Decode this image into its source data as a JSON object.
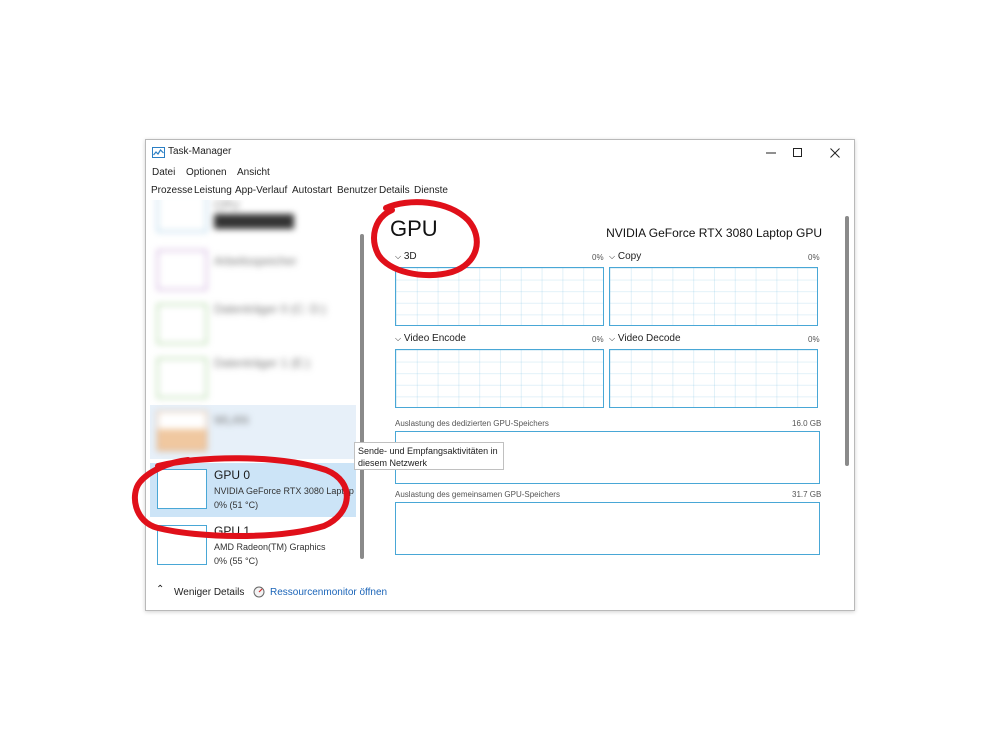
{
  "window": {
    "title": "Task-Manager"
  },
  "menu": [
    "Datei",
    "Optionen",
    "Ansicht"
  ],
  "tabs": [
    "Prozesse",
    "Leistung",
    "App-Verlauf",
    "Autostart",
    "Benutzer",
    "Details",
    "Dienste"
  ],
  "active_tab": "Leistung",
  "sidebar": {
    "items": [
      {
        "title": "CPU",
        "subtitle": "",
        "blurred": true
      },
      {
        "title": "Arbeitsspeicher",
        "subtitle": "",
        "blurred": true
      },
      {
        "title": "Datenträger 0 (C: D:)",
        "subtitle": "",
        "blurred": true
      },
      {
        "title": "Datenträger 1 (E:)",
        "subtitle": "",
        "blurred": true
      },
      {
        "title": "WLAN",
        "subtitle": "",
        "blurred": true
      },
      {
        "title": "GPU 0",
        "subtitle": "NVIDIA GeForce RTX 3080 Laptop",
        "value": "0%  (51 °C)"
      },
      {
        "title": "GPU 1",
        "subtitle": "AMD Radeon(TM) Graphics",
        "value": "0%  (55 °C)"
      }
    ],
    "colors": {
      "cpu": "#7fb8dc",
      "memory": "#b07cc6",
      "disk": "#7fbf6a",
      "wlan": "#d8a070",
      "gpu": "#49a7d6"
    }
  },
  "tooltip": "Sende- und Empfangsaktivitäten in diesem Netzwerk",
  "main": {
    "title": "GPU",
    "model": "NVIDIA GeForce RTX 3080 Laptop GPU",
    "engines": [
      {
        "name": "3D",
        "percent": "0%"
      },
      {
        "name": "Copy",
        "percent": "0%"
      },
      {
        "name": "Video Encode",
        "percent": "0%"
      },
      {
        "name": "Video Decode",
        "percent": "0%"
      }
    ],
    "dedicated_memory": {
      "label": "Auslastung des dedizierten GPU-Speichers",
      "max": "16.0 GB"
    },
    "shared_memory": {
      "label": "Auslastung des gemeinsamen GPU-Speichers",
      "max": "31.7 GB"
    }
  },
  "footer": {
    "fewer_details": "Weniger Details",
    "resource_monitor": "Ressourcenmonitor öffnen"
  },
  "annotation_color": "#e0101a"
}
